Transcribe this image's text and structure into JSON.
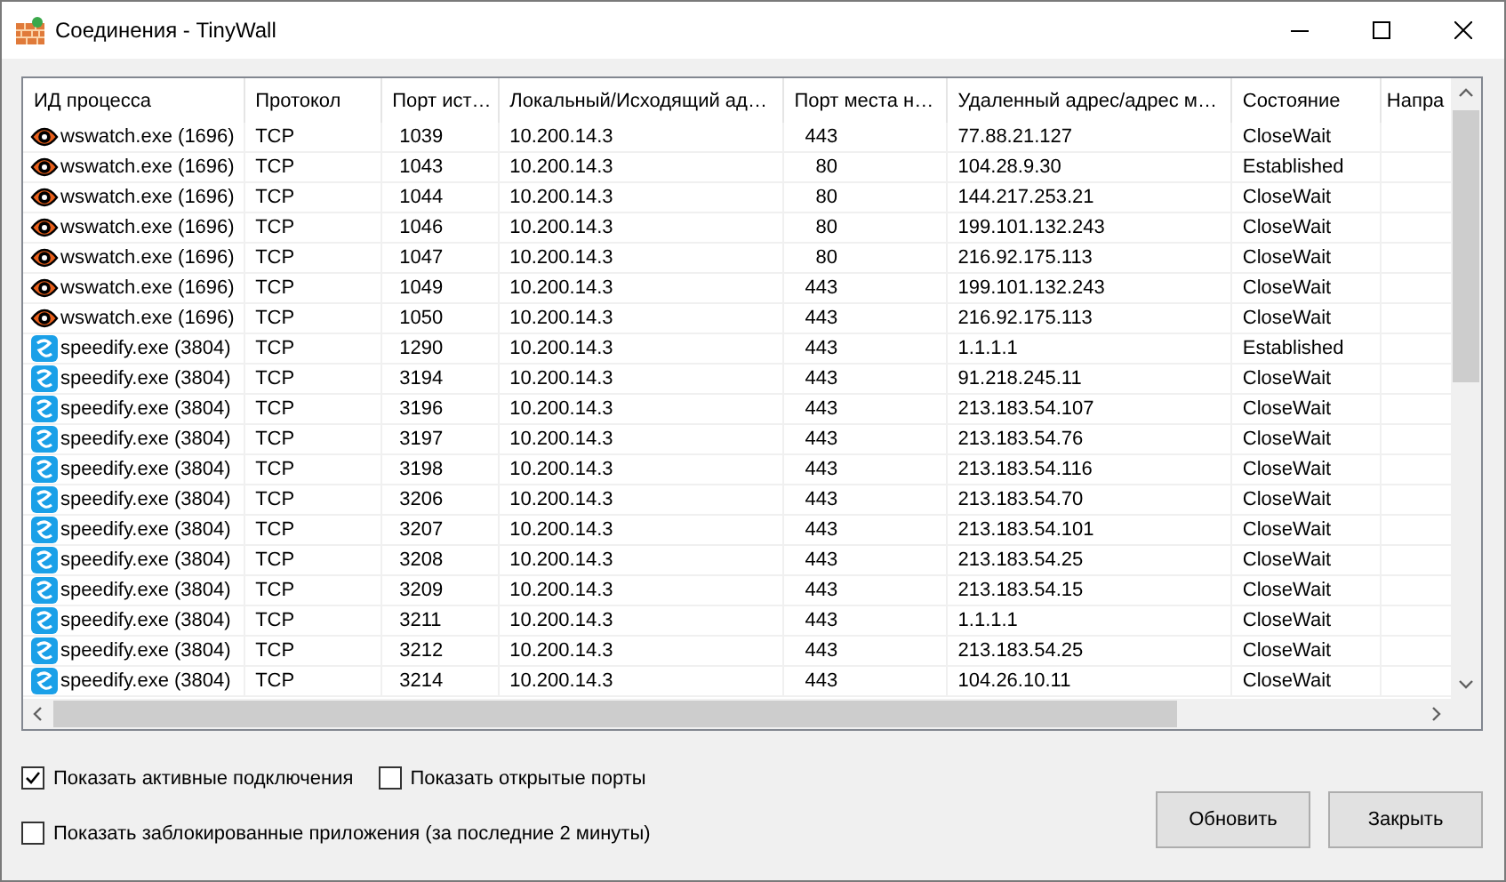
{
  "window": {
    "title": "Соединения - TinyWall"
  },
  "table": {
    "columns": [
      "ИД процесса",
      "Протокол",
      "Порт ист…",
      "Локальный/Исходящий ад…",
      "Порт места н…",
      "Удаленный адрес/адрес м…",
      "Состояние",
      "Напра"
    ],
    "rows": [
      {
        "kind": "eye",
        "process": "wswatch.exe (1696)",
        "protocol": "TCP",
        "src_port": "1039",
        "local": "10.200.14.3",
        "dst_port": "443",
        "remote": "77.88.21.127",
        "state": "CloseWait"
      },
      {
        "kind": "eye",
        "process": "wswatch.exe (1696)",
        "protocol": "TCP",
        "src_port": "1043",
        "local": "10.200.14.3",
        "dst_port": "80",
        "remote": "104.28.9.30",
        "state": "Established"
      },
      {
        "kind": "eye",
        "process": "wswatch.exe (1696)",
        "protocol": "TCP",
        "src_port": "1044",
        "local": "10.200.14.3",
        "dst_port": "80",
        "remote": "144.217.253.21",
        "state": "CloseWait"
      },
      {
        "kind": "eye",
        "process": "wswatch.exe (1696)",
        "protocol": "TCP",
        "src_port": "1046",
        "local": "10.200.14.3",
        "dst_port": "80",
        "remote": "199.101.132.243",
        "state": "CloseWait"
      },
      {
        "kind": "eye",
        "process": "wswatch.exe (1696)",
        "protocol": "TCP",
        "src_port": "1047",
        "local": "10.200.14.3",
        "dst_port": "80",
        "remote": "216.92.175.113",
        "state": "CloseWait"
      },
      {
        "kind": "eye",
        "process": "wswatch.exe (1696)",
        "protocol": "TCP",
        "src_port": "1049",
        "local": "10.200.14.3",
        "dst_port": "443",
        "remote": "199.101.132.243",
        "state": "CloseWait"
      },
      {
        "kind": "eye",
        "process": "wswatch.exe (1696)",
        "protocol": "TCP",
        "src_port": "1050",
        "local": "10.200.14.3",
        "dst_port": "443",
        "remote": "216.92.175.113",
        "state": "CloseWait"
      },
      {
        "kind": "speedify",
        "process": "speedify.exe (3804)",
        "protocol": "TCP",
        "src_port": "1290",
        "local": "10.200.14.3",
        "dst_port": "443",
        "remote": "1.1.1.1",
        "state": "Established"
      },
      {
        "kind": "speedify",
        "process": "speedify.exe (3804)",
        "protocol": "TCP",
        "src_port": "3194",
        "local": "10.200.14.3",
        "dst_port": "443",
        "remote": "91.218.245.11",
        "state": "CloseWait"
      },
      {
        "kind": "speedify",
        "process": "speedify.exe (3804)",
        "protocol": "TCP",
        "src_port": "3196",
        "local": "10.200.14.3",
        "dst_port": "443",
        "remote": "213.183.54.107",
        "state": "CloseWait"
      },
      {
        "kind": "speedify",
        "process": "speedify.exe (3804)",
        "protocol": "TCP",
        "src_port": "3197",
        "local": "10.200.14.3",
        "dst_port": "443",
        "remote": "213.183.54.76",
        "state": "CloseWait"
      },
      {
        "kind": "speedify",
        "process": "speedify.exe (3804)",
        "protocol": "TCP",
        "src_port": "3198",
        "local": "10.200.14.3",
        "dst_port": "443",
        "remote": "213.183.54.116",
        "state": "CloseWait"
      },
      {
        "kind": "speedify",
        "process": "speedify.exe (3804)",
        "protocol": "TCP",
        "src_port": "3206",
        "local": "10.200.14.3",
        "dst_port": "443",
        "remote": "213.183.54.70",
        "state": "CloseWait"
      },
      {
        "kind": "speedify",
        "process": "speedify.exe (3804)",
        "protocol": "TCP",
        "src_port": "3207",
        "local": "10.200.14.3",
        "dst_port": "443",
        "remote": "213.183.54.101",
        "state": "CloseWait"
      },
      {
        "kind": "speedify",
        "process": "speedify.exe (3804)",
        "protocol": "TCP",
        "src_port": "3208",
        "local": "10.200.14.3",
        "dst_port": "443",
        "remote": "213.183.54.25",
        "state": "CloseWait"
      },
      {
        "kind": "speedify",
        "process": "speedify.exe (3804)",
        "protocol": "TCP",
        "src_port": "3209",
        "local": "10.200.14.3",
        "dst_port": "443",
        "remote": "213.183.54.15",
        "state": "CloseWait"
      },
      {
        "kind": "speedify",
        "process": "speedify.exe (3804)",
        "protocol": "TCP",
        "src_port": "3211",
        "local": "10.200.14.3",
        "dst_port": "443",
        "remote": "1.1.1.1",
        "state": "CloseWait"
      },
      {
        "kind": "speedify",
        "process": "speedify.exe (3804)",
        "protocol": "TCP",
        "src_port": "3212",
        "local": "10.200.14.3",
        "dst_port": "443",
        "remote": "213.183.54.25",
        "state": "CloseWait"
      },
      {
        "kind": "speedify",
        "process": "speedify.exe (3804)",
        "protocol": "TCP",
        "src_port": "3214",
        "local": "10.200.14.3",
        "dst_port": "443",
        "remote": "104.26.10.11",
        "state": "CloseWait"
      }
    ]
  },
  "options": [
    {
      "label": "Показать активные подключения",
      "checked": true
    },
    {
      "label": "Показать открытые порты",
      "checked": false
    },
    {
      "label": "Показать заблокированные приложения (за последние 2 минуты)",
      "checked": false
    }
  ],
  "buttons": [
    "Обновить",
    "Закрыть"
  ]
}
